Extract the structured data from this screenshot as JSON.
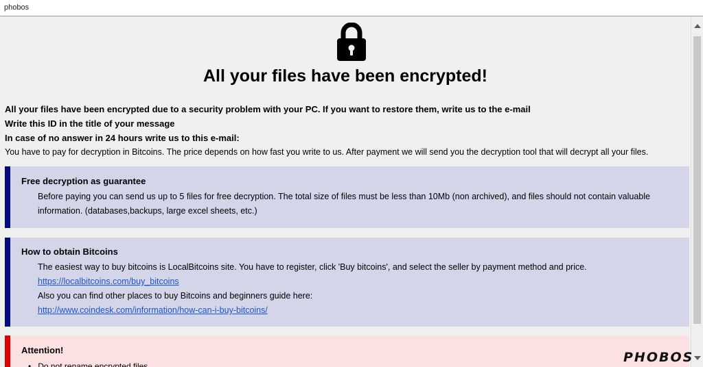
{
  "window": {
    "title": "phobos"
  },
  "icons": {
    "lock": "padlock-icon"
  },
  "heading": "All your files have been encrypted!",
  "intro": {
    "line1": "All your files have been encrypted due to a security problem with your PC. If you want to restore them, write us to the e-mail",
    "line2": "Write this ID in the title of your message",
    "line3": "In case of no answer in 24 hours write us to this e-mail:",
    "line4": "You have to pay for decryption in Bitcoins. The price depends on how fast you write to us. After payment we will send you the decryption tool that will decrypt all your files."
  },
  "free_decryption": {
    "title": "Free decryption as guarantee",
    "text": "Before paying you can send us up to 5 files for free decryption. The total size of files must be less than 10Mb (non archived), and files should not contain valuable information. (databases,backups, large excel sheets, etc.)"
  },
  "bitcoins": {
    "title": "How to obtain Bitcoins",
    "text1": "The easiest way to buy bitcoins is LocalBitcoins site. You have to register, click 'Buy bitcoins', and select the seller by payment method and price.",
    "link1": "https://localbitcoins.com/buy_bitcoins",
    "text2": "Also you can find other places to buy Bitcoins and beginners guide here:",
    "link2": "http://www.coindesk.com/information/how-can-i-buy-bitcoins/"
  },
  "attention": {
    "title": "Attention!",
    "bullet1": "Do not rename encrypted files."
  },
  "logo_text": "PHOBOS",
  "colors": {
    "info_box": "#d5d5ea",
    "info_border": "#000c80",
    "attention_box": "#fbe1e1",
    "attention_border": "#e00000",
    "link": "#1a56c8"
  }
}
